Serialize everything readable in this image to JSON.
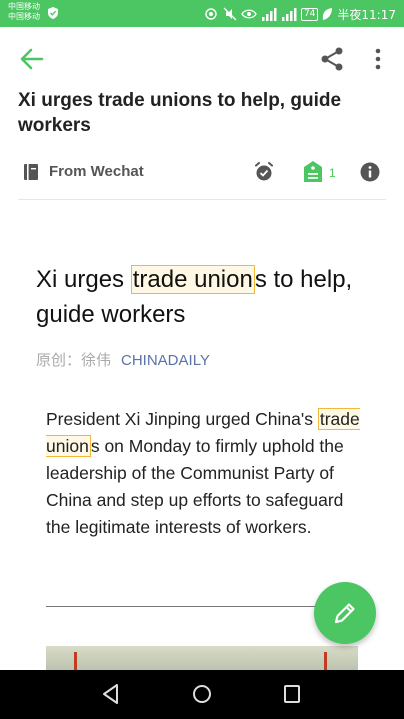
{
  "status_bar": {
    "carrier_1": "中国移动",
    "carrier_2": "中国移动",
    "battery": "74",
    "time": "半夜11:17"
  },
  "app_bar": {
    "back_icon": "arrow-left",
    "share_icon": "share",
    "more_icon": "more-vertical"
  },
  "note": {
    "title": "Xi urges trade unions to help, guide workers",
    "source_label": "From Wechat",
    "tag_count": "1"
  },
  "article": {
    "title_before": "Xi urges ",
    "title_highlight": "trade union",
    "title_after": "s to help, guide workers",
    "byline_author": "原创：徐伟",
    "byline_source": "CHINADAILY",
    "body_before": "President Xi Jinping urged China's ",
    "body_highlight": "trade union",
    "body_after": "s on Monday to firmly uphold the leadership of the Communist Party of China and step up efforts to safeguard the legitimate interests of workers."
  },
  "colors": {
    "accent": "#4cc563",
    "highlight_border": "#f2b83c",
    "highlight_fill": "#fff8e4",
    "source_link": "#5a74a5"
  }
}
